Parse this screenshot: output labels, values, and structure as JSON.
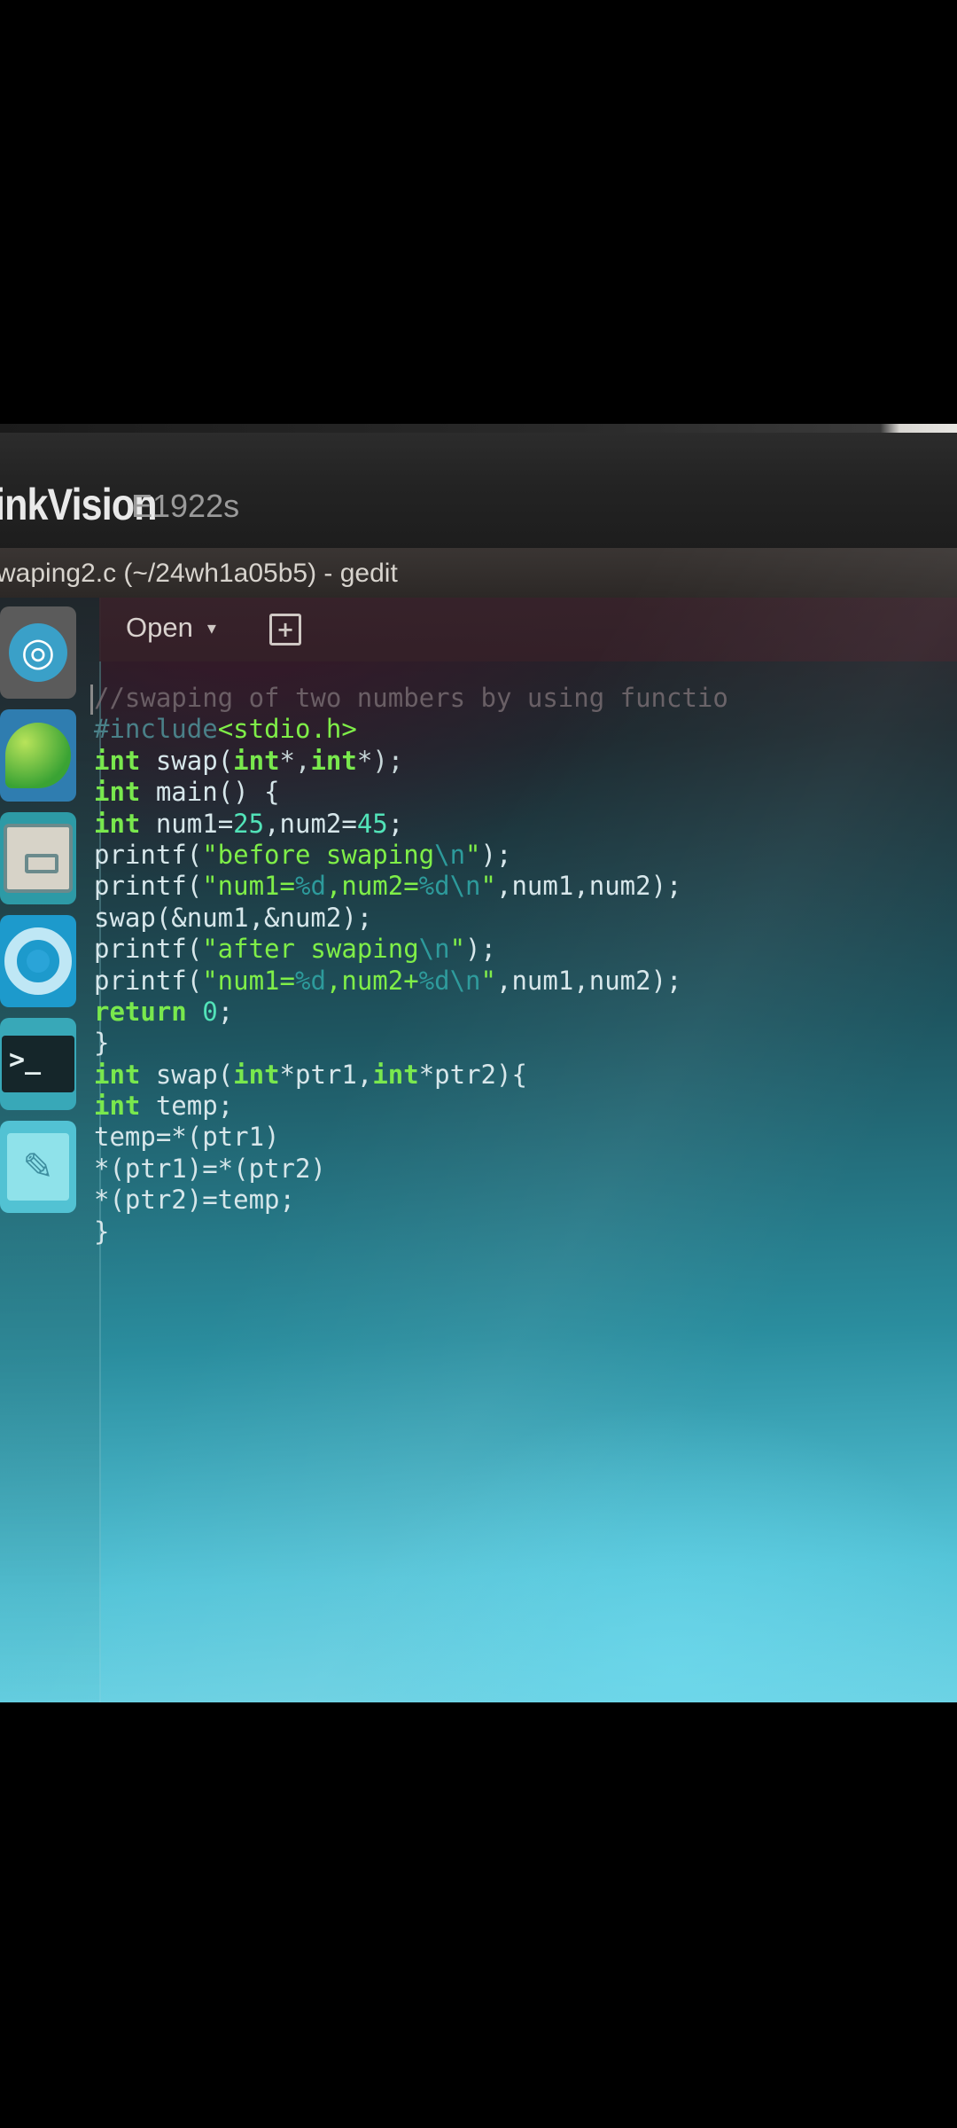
{
  "monitor": {
    "brand": "inkVision",
    "model": "E1922s"
  },
  "window": {
    "title": "waping2.c (~/24wh1a05b5) - gedit"
  },
  "toolbar": {
    "open_label": "Open",
    "open_caret": "▾",
    "new_tab_icon": "new-document-icon"
  },
  "launcher": {
    "items": [
      {
        "icon": "ubuntu-dash-icon"
      },
      {
        "icon": "app-leaf-icon"
      },
      {
        "icon": "files-icon"
      },
      {
        "icon": "chromium-icon"
      },
      {
        "icon": "terminal-icon"
      },
      {
        "icon": "text-editor-icon"
      }
    ]
  },
  "editor": {
    "lines": [
      [
        {
          "t": "//swaping of two numbers by using functio",
          "c": "comment"
        }
      ],
      [
        {
          "t": "#include",
          "c": "pre"
        },
        {
          "t": "<stdio.h>",
          "c": "str"
        }
      ],
      [
        {
          "t": "int",
          "c": "kw"
        },
        {
          "t": " swap(",
          "c": ""
        },
        {
          "t": "int",
          "c": "kw"
        },
        {
          "t": "*,",
          "c": "ptr"
        },
        {
          "t": "int",
          "c": "kw"
        },
        {
          "t": "*);",
          "c": "ptr"
        }
      ],
      [
        {
          "t": "int",
          "c": "kw"
        },
        {
          "t": " main() {",
          "c": ""
        }
      ],
      [
        {
          "t": "int",
          "c": "kw"
        },
        {
          "t": " num1=",
          "c": ""
        },
        {
          "t": "25",
          "c": "num"
        },
        {
          "t": ",num2=",
          "c": ""
        },
        {
          "t": "45",
          "c": "num"
        },
        {
          "t": ";",
          "c": ""
        }
      ],
      [
        {
          "t": "printf(",
          "c": ""
        },
        {
          "t": "\"before swaping",
          "c": "str"
        },
        {
          "t": "\\n",
          "c": "esc"
        },
        {
          "t": "\"",
          "c": "str"
        },
        {
          "t": ");",
          "c": ""
        }
      ],
      [
        {
          "t": "printf(",
          "c": ""
        },
        {
          "t": "\"num1=",
          "c": "str"
        },
        {
          "t": "%d",
          "c": "esc"
        },
        {
          "t": ",num2=",
          "c": "str"
        },
        {
          "t": "%d\\n",
          "c": "esc"
        },
        {
          "t": "\"",
          "c": "str"
        },
        {
          "t": ",num1,num2);",
          "c": ""
        }
      ],
      [
        {
          "t": "swap(&num1,&num2);",
          "c": ""
        }
      ],
      [
        {
          "t": "printf(",
          "c": ""
        },
        {
          "t": "\"after swaping",
          "c": "str"
        },
        {
          "t": "\\n",
          "c": "esc"
        },
        {
          "t": "\"",
          "c": "str"
        },
        {
          "t": ");",
          "c": ""
        }
      ],
      [
        {
          "t": "printf(",
          "c": ""
        },
        {
          "t": "\"num1=",
          "c": "str"
        },
        {
          "t": "%d",
          "c": "esc"
        },
        {
          "t": ",num2+",
          "c": "str"
        },
        {
          "t": "%d\\n",
          "c": "esc"
        },
        {
          "t": "\"",
          "c": "str"
        },
        {
          "t": ",num1,num2);",
          "c": ""
        }
      ],
      [
        {
          "t": "return",
          "c": "kw"
        },
        {
          "t": " ",
          "c": ""
        },
        {
          "t": "0",
          "c": "num"
        },
        {
          "t": ";",
          "c": ""
        }
      ],
      [
        {
          "t": "}",
          "c": ""
        }
      ],
      [
        {
          "t": "int",
          "c": "kw"
        },
        {
          "t": " swap(",
          "c": ""
        },
        {
          "t": "int",
          "c": "kw"
        },
        {
          "t": "*ptr1,",
          "c": ""
        },
        {
          "t": "int",
          "c": "kw"
        },
        {
          "t": "*ptr2){",
          "c": ""
        }
      ],
      [
        {
          "t": "int",
          "c": "kw"
        },
        {
          "t": " temp;",
          "c": ""
        }
      ],
      [
        {
          "t": "temp=*(ptr1)",
          "c": ""
        }
      ],
      [
        {
          "t": "*(ptr1)=*(ptr2)",
          "c": ""
        }
      ],
      [
        {
          "t": "*(ptr2)=temp;",
          "c": ""
        }
      ],
      [
        {
          "t": "}",
          "c": ""
        }
      ]
    ]
  }
}
